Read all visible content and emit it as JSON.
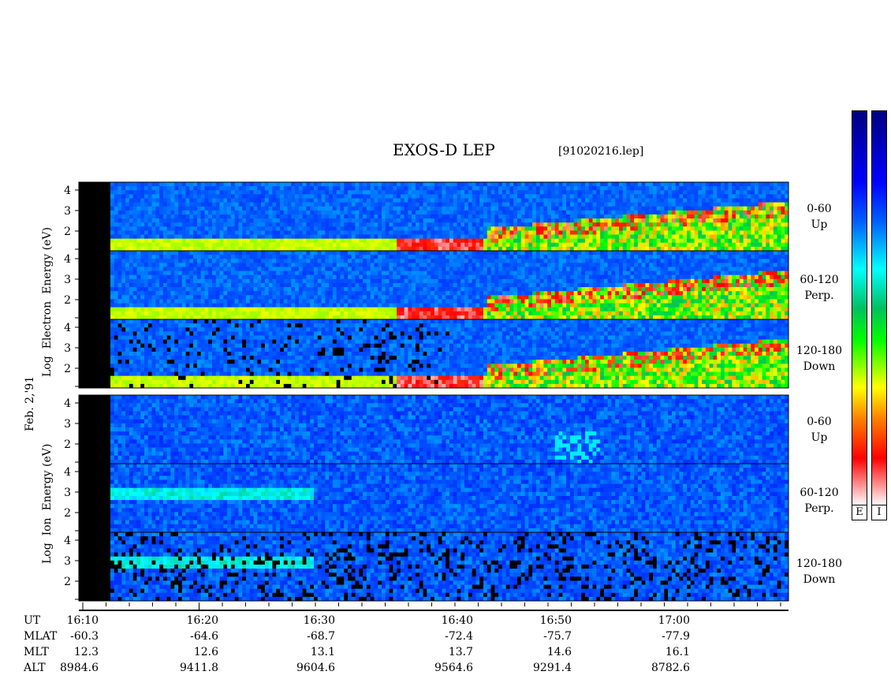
{
  "header": {
    "title": "EXOS-D LEP",
    "file": "[91020216.lep]"
  },
  "date_label": "Feb. 2,'91",
  "electron_label": [
    "Log",
    "Electron",
    "Energy",
    "(eV)"
  ],
  "ion_label": [
    "Log",
    "Ion",
    "Energy",
    "(eV)"
  ],
  "panels": [
    {
      "angle": "0-60",
      "dir": "Up"
    },
    {
      "angle": "60-120",
      "dir": "Perp."
    },
    {
      "angle": "120-180",
      "dir": "Down"
    },
    {
      "angle": "0-60",
      "dir": "Up"
    },
    {
      "angle": "60-120",
      "dir": "Perp."
    },
    {
      "angle": "120-180",
      "dir": "Down"
    }
  ],
  "colorbars": [
    {
      "label": "E"
    },
    {
      "label": "I"
    }
  ],
  "row_names": [
    "UT",
    "MLAT",
    "MLT",
    "ALT"
  ],
  "table": [
    {
      "UT": "16:10",
      "MLAT": "-60.3",
      "MLT": "12.3",
      "ALT": "8984.6"
    },
    {
      "UT": "16:20",
      "MLAT": "-64.6",
      "MLT": "12.6",
      "ALT": "9411.8"
    },
    {
      "UT": "16:30",
      "MLAT": "-68.7",
      "MLT": "13.1",
      "ALT": "9604.6"
    },
    {
      "UT": "16:40",
      "MLAT": "-72.4",
      "MLT": "13.7",
      "ALT": "9564.6"
    },
    {
      "UT": "16:50",
      "MLAT": "-75.7",
      "MLT": "14.6",
      "ALT": "9291.4"
    },
    {
      "UT": "17:00",
      "MLAT": "-77.9",
      "MLT": "16.1",
      "ALT": "8782.6"
    }
  ],
  "chart_data": {
    "type": "heatmap",
    "title": "EXOS-D LEP",
    "x_ticks": [
      "16:10",
      "16:20",
      "16:30",
      "16:40",
      "16:50",
      "17:00"
    ],
    "y_ticks": [
      "2",
      "3",
      "4"
    ],
    "species": [
      "Electron",
      "Ion"
    ],
    "colors": {
      "low": "#000080",
      "mid": "#00ffff",
      "high": "#ff0000",
      "top": "#ffffff"
    }
  }
}
